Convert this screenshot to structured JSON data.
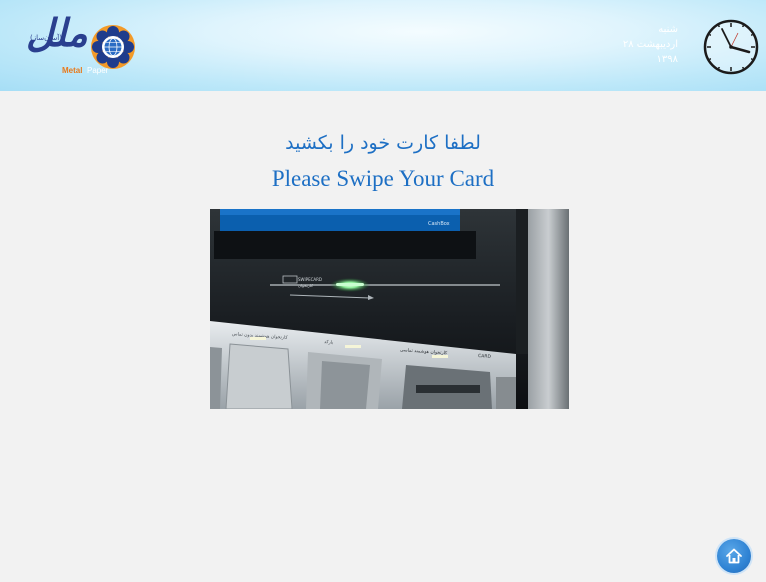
{
  "header": {
    "logo": {
      "name": "Bank Melli logo",
      "script_text": "ملل",
      "tagline": "(آسان‌ساز)",
      "metal_word": "Metal",
      "metal_word2": "Paper"
    },
    "date": {
      "weekday": "شنبه",
      "day_month": "۲۸ اردیبهشت",
      "year": "۱۳۹۸"
    },
    "clock_icon": "analog-clock-icon"
  },
  "main": {
    "prompt_fa": "لطفا کارت خود را بکشید",
    "prompt_en": "Please Swipe Your Card"
  },
  "photo": {
    "slot_label_fa": "کارتخوان",
    "slot_label_en": "SWIPECARD",
    "panel_label_1": "کارتخوان هوشمند بدون تماس",
    "panel_label_2": "بارکد",
    "panel_label_3": "کارتخوان هوشمند تماسی",
    "panel_label_3_en": "CARD",
    "screen_label": "CashBox"
  },
  "footer": {
    "home_icon": "home-icon"
  },
  "colors": {
    "accent": "#1d6fc4",
    "header_light": "#dff4fd",
    "header_dark": "#a6def6",
    "background": "#f2f2f2",
    "home_button": "#2f83d4"
  }
}
